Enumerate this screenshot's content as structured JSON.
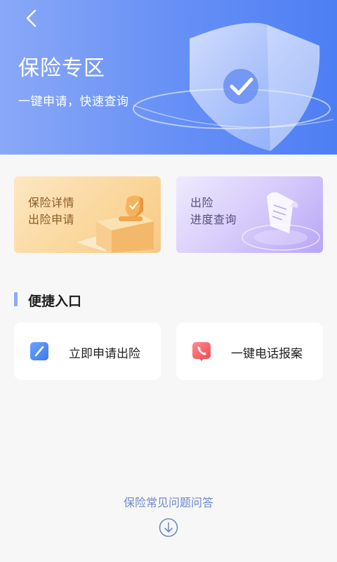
{
  "header": {
    "title": "保险专区",
    "subtitle": "一键申请，快速查询"
  },
  "cards": [
    {
      "line1": "保险详情",
      "line2": "出险申请"
    },
    {
      "line1": "出险",
      "line2": "进度查询"
    }
  ],
  "quick_entry": {
    "title": "便捷入口",
    "items": [
      {
        "label": "立即申请出险",
        "icon": "pen-icon"
      },
      {
        "label": "一键电话报案",
        "icon": "phone-icon"
      }
    ]
  },
  "faq": {
    "label": "保险常见问题问答"
  },
  "colors": {
    "hero_gradient_start": "#8aa8f7",
    "hero_gradient_end": "#4d7ef3",
    "accent": "#8fa9f4",
    "faq_text": "#6e89c8"
  }
}
